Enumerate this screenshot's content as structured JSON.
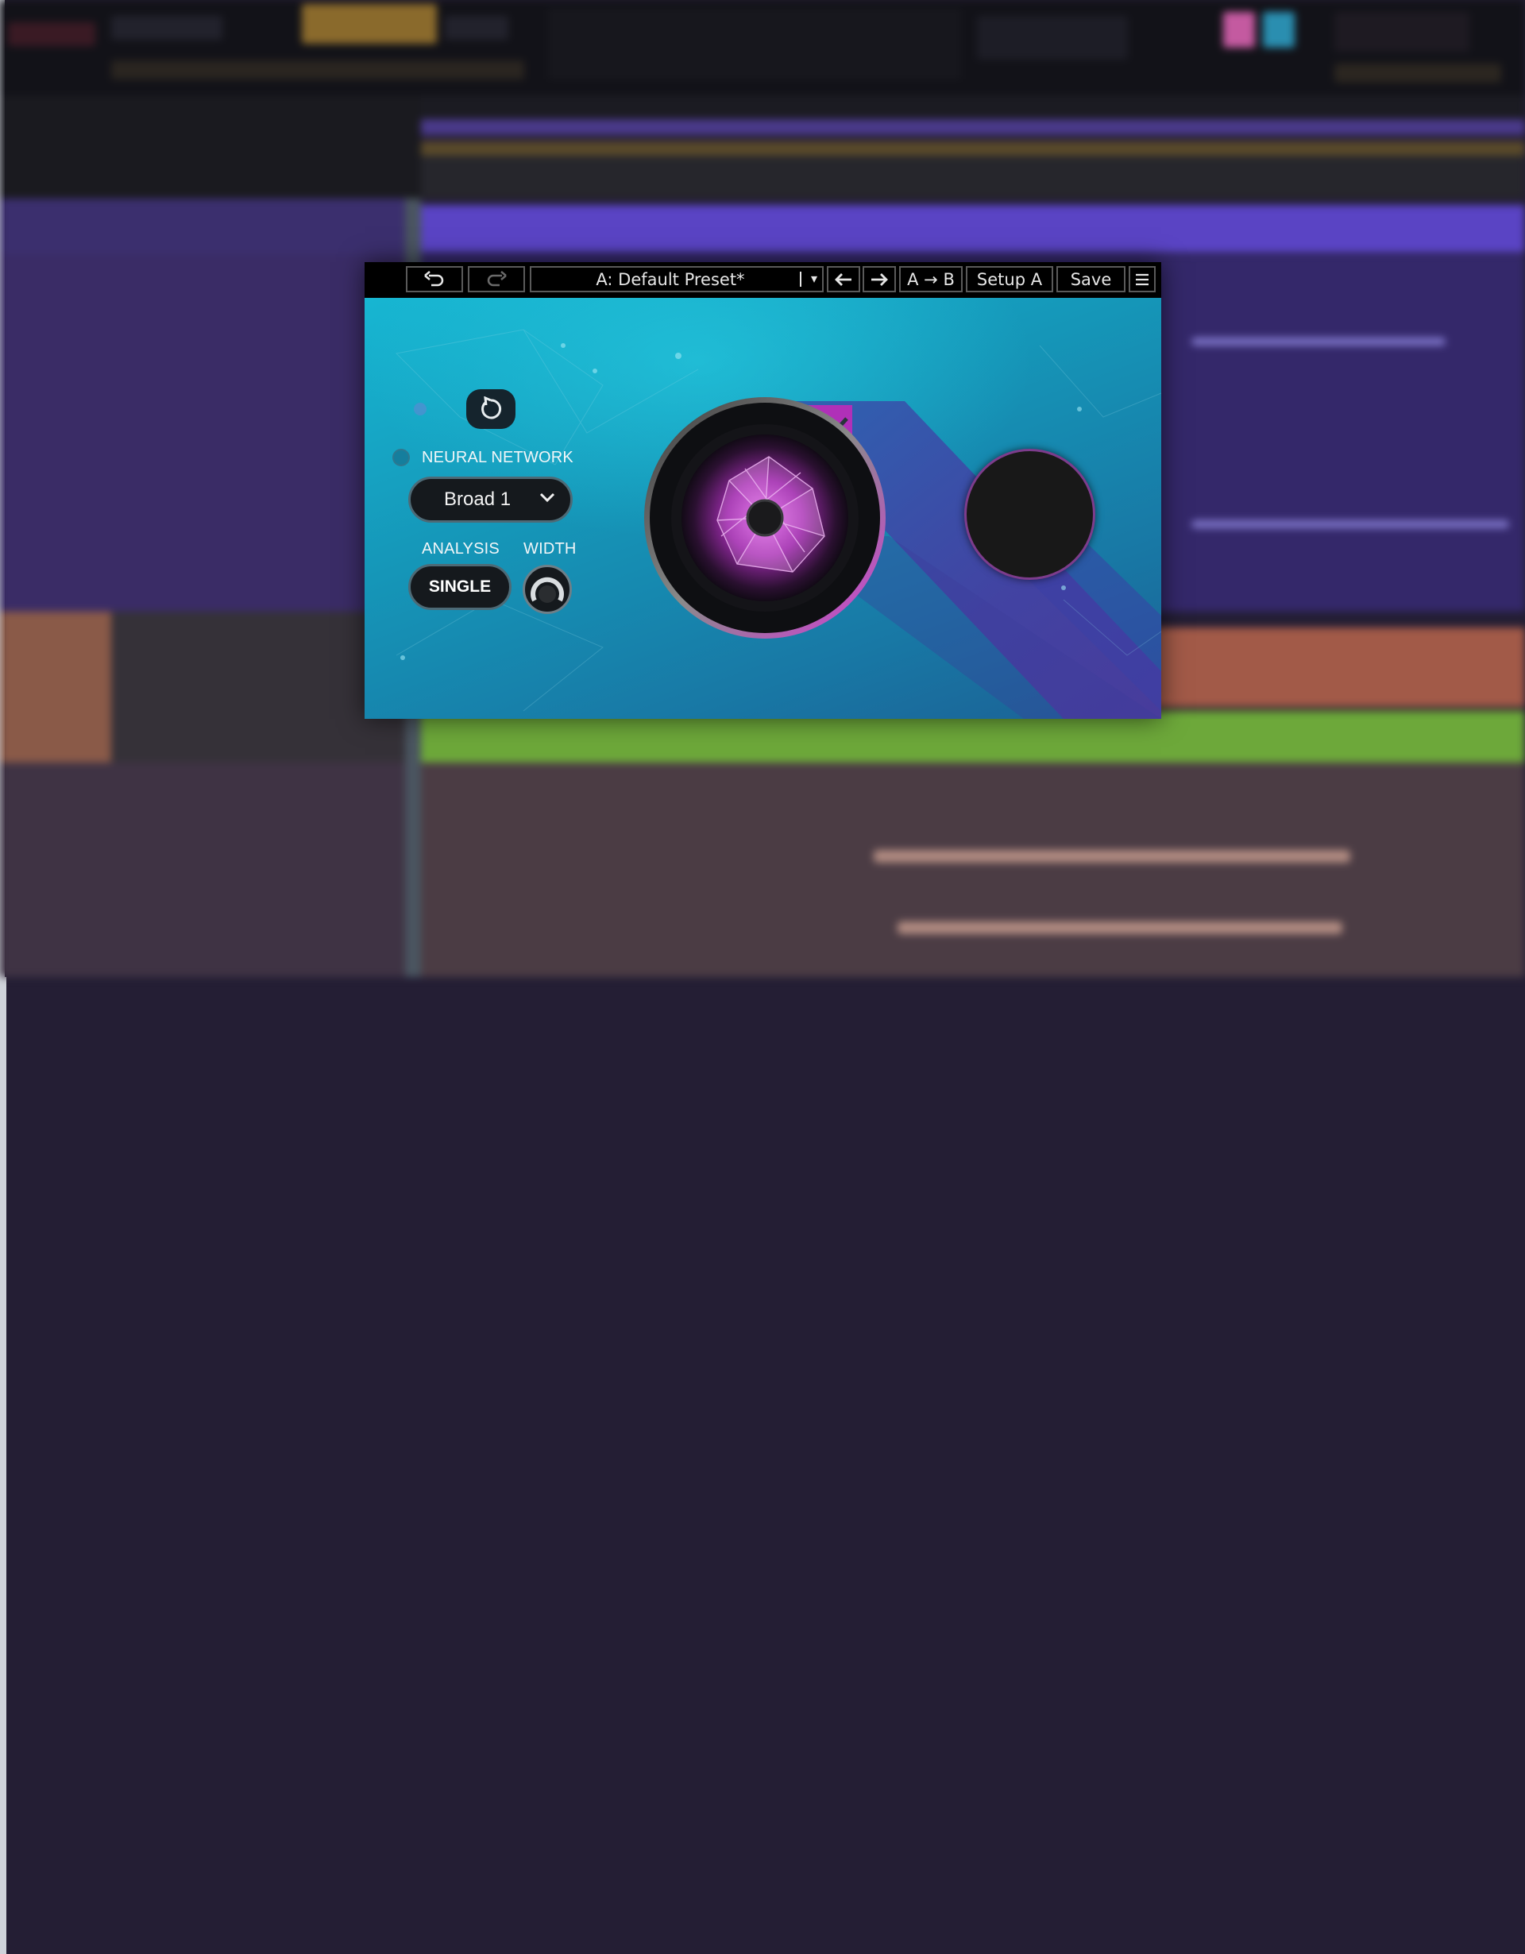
{
  "titlebar": {
    "undo_icon": "undo-icon",
    "redo_icon": "redo-icon",
    "preset_name": "A: Default Preset*",
    "prev_icon": "arrow-left-icon",
    "next_icon": "arrow-right-icon",
    "ab_label": "A → B",
    "setup_label": "Setup A",
    "save_label": "Save",
    "menu_icon": "hamburger-menu-icon"
  },
  "controls": {
    "neural_network_label": "NEURAL NETWORK",
    "neural_network_value": "Broad 1",
    "analysis_label": "ANALYSIS",
    "analysis_value": "SINGLE",
    "width_label": "WIDTH"
  },
  "colors": {
    "accent_magenta": "#d23cd6",
    "background_teal": "#17b6d2",
    "stripe_purple": "#3f3c9a"
  }
}
